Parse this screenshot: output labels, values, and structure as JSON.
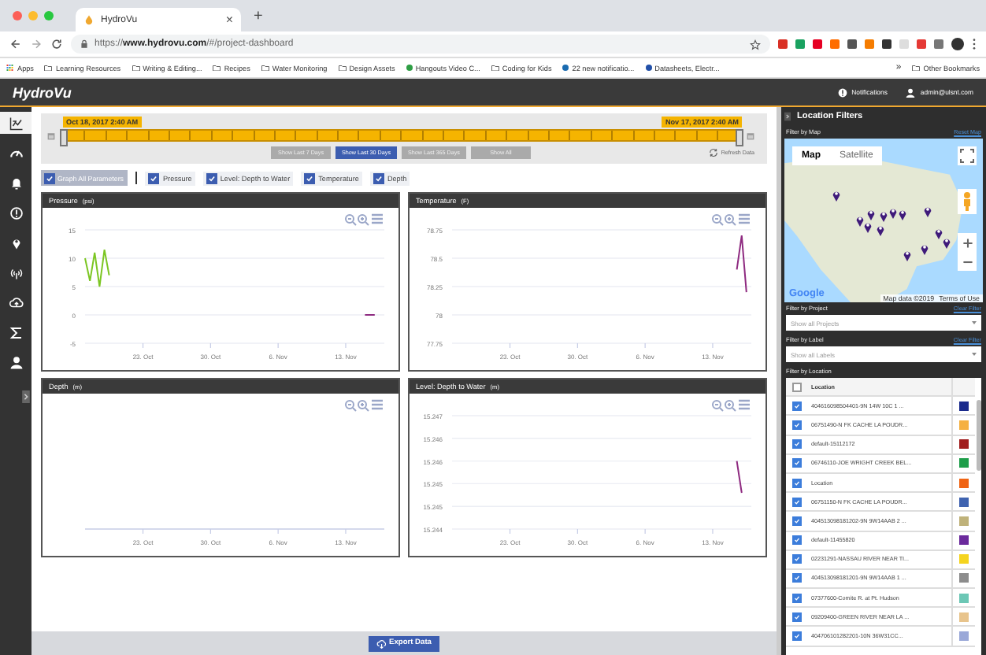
{
  "browser": {
    "tab": {
      "title": "HydroVu",
      "close": "×"
    },
    "new_tab": "+",
    "url": "https://**www.hydrovu.com**/#/project-dashboard",
    "bookmarks": [
      {
        "label": "Apps",
        "kind": "apps"
      },
      {
        "label": "Learning Resources",
        "kind": "folder"
      },
      {
        "label": "Writing & Editing...",
        "kind": "folder"
      },
      {
        "label": "Recipes",
        "kind": "folder"
      },
      {
        "label": "Water Monitoring",
        "kind": "folder"
      },
      {
        "label": "Design Assets",
        "kind": "folder"
      },
      {
        "label": "Hangouts Video C...",
        "kind": "site",
        "color": "#2e9e44"
      },
      {
        "label": "Coding for Kids",
        "kind": "folder"
      },
      {
        "label": "22 new notificatio...",
        "kind": "site",
        "color": "#1a6bb0"
      },
      {
        "label": "Datasheets, Electr...",
        "kind": "site",
        "color": "#2250a8"
      }
    ],
    "bookmarks_more": "»",
    "other_bookmarks": "Other Bookmarks"
  },
  "app": {
    "logo": "HydroVu",
    "notifications": "Notifications",
    "user": "admin@ulsnt.com"
  },
  "nav": [
    {
      "kind": "dashboard",
      "selected": true
    },
    {
      "kind": "gauge",
      "selected": false
    },
    {
      "kind": "bell",
      "selected": false
    },
    {
      "kind": "alert",
      "selected": false
    },
    {
      "kind": "pin",
      "selected": false
    },
    {
      "kind": "antenna",
      "selected": false
    },
    {
      "kind": "cloud",
      "selected": false
    },
    {
      "kind": "sigma",
      "selected": false
    },
    {
      "kind": "user",
      "selected": false
    }
  ],
  "time_range": {
    "start": "Oct 18, 2017 2:40 AM",
    "end": "Nov 17, 2017 2:40 AM",
    "slider": {
      "level": 1
    },
    "presets": [
      {
        "label": "Show Last 7 Days",
        "selected": false
      },
      {
        "label": "Show Last 30 Days",
        "selected": true
      },
      {
        "label": "Show Last 365 Days",
        "selected": false
      },
      {
        "label": "Show All",
        "selected": false
      }
    ],
    "refresh": "Refresh Data"
  },
  "parameters": {
    "all": {
      "label": "Graph All Parameters",
      "checked": true
    },
    "items": [
      {
        "label": "Pressure",
        "checked": true
      },
      {
        "label": "Level: Depth to Water",
        "checked": true
      },
      {
        "label": "Temperature",
        "checked": true
      },
      {
        "label": "Depth",
        "checked": true
      }
    ]
  },
  "charts": [
    {
      "title": "Pressure",
      "unit": "(psi)",
      "chart_data": {
        "type": "line",
        "grid": true,
        "ylim": [
          -5,
          15
        ],
        "yticks": [
          -5,
          0,
          5,
          10,
          15
        ],
        "categories": [
          null,
          null,
          null,
          null,
          null,
          null,
          null,
          null,
          null,
          null,
          null,
          null,
          "23. Oct",
          null,
          null,
          null,
          null,
          null,
          null,
          null,
          null,
          null,
          null,
          null,
          null,
          null,
          "30. Oct",
          null,
          null,
          null,
          null,
          null,
          null,
          null,
          null,
          null,
          null,
          null,
          null,
          null,
          "6. Nov",
          null,
          null,
          null,
          null,
          null,
          null,
          null,
          null,
          null,
          null,
          null,
          null,
          null,
          "13. Nov",
          null,
          null,
          null,
          null,
          null,
          null,
          null,
          null
        ],
        "series": [
          {
            "color": "#7cc623",
            "values": [
              10,
              6,
              11,
              5,
              11.5,
              7,
              null,
              null,
              null,
              null,
              null,
              null,
              null,
              null,
              null,
              null,
              null,
              null,
              null,
              null,
              null,
              null,
              null,
              null,
              null,
              null,
              null,
              null,
              null,
              null,
              null,
              null,
              null,
              null,
              null,
              null,
              null,
              null,
              null,
              null,
              null,
              null,
              null,
              null,
              null,
              null,
              null,
              null,
              null,
              null,
              null,
              null,
              null,
              null,
              null,
              null,
              null,
              null,
              null,
              null,
              null,
              null,
              null
            ]
          },
          {
            "color": "#8e2a80",
            "values": [
              null,
              null,
              null,
              null,
              null,
              null,
              null,
              null,
              null,
              null,
              null,
              null,
              null,
              null,
              null,
              null,
              null,
              null,
              null,
              null,
              null,
              null,
              null,
              null,
              null,
              null,
              null,
              null,
              null,
              null,
              null,
              null,
              null,
              null,
              null,
              null,
              null,
              null,
              null,
              null,
              null,
              null,
              null,
              null,
              null,
              null,
              null,
              null,
              null,
              null,
              null,
              null,
              null,
              null,
              null,
              null,
              null,
              null,
              0,
              0,
              0,
              null,
              null
            ]
          }
        ]
      }
    },
    {
      "title": "Temperature",
      "unit": "(F)",
      "chart_data": {
        "type": "line",
        "grid": true,
        "ylim": [
          77.75,
          78.75
        ],
        "yticks": [
          {
            "value": 77.75,
            "label": "77.75"
          },
          {
            "value": 78,
            "label": "78"
          },
          {
            "value": 78.25,
            "label": "78.25"
          },
          {
            "value": 78.5,
            "label": "78.5"
          },
          {
            "value": 78.75,
            "label": "78.75"
          }
        ],
        "categories": [
          null,
          null,
          null,
          null,
          null,
          null,
          null,
          null,
          null,
          null,
          null,
          null,
          "23. Oct",
          null,
          null,
          null,
          null,
          null,
          null,
          null,
          null,
          null,
          null,
          null,
          null,
          null,
          "30. Oct",
          null,
          null,
          null,
          null,
          null,
          null,
          null,
          null,
          null,
          null,
          null,
          null,
          null,
          "6. Nov",
          null,
          null,
          null,
          null,
          null,
          null,
          null,
          null,
          null,
          null,
          null,
          null,
          null,
          "13. Nov",
          null,
          null,
          null,
          null,
          null,
          null,
          null,
          null
        ],
        "series": [
          {
            "color": "#8e2a80",
            "values": [
              null,
              null,
              null,
              null,
              null,
              null,
              null,
              null,
              null,
              null,
              null,
              null,
              null,
              null,
              null,
              null,
              null,
              null,
              null,
              null,
              null,
              null,
              null,
              null,
              null,
              null,
              null,
              null,
              null,
              null,
              null,
              null,
              null,
              null,
              null,
              null,
              null,
              null,
              null,
              null,
              null,
              null,
              null,
              null,
              null,
              null,
              null,
              null,
              null,
              null,
              null,
              null,
              null,
              null,
              null,
              null,
              null,
              null,
              null,
              78.4,
              78.7,
              78.2,
              null
            ]
          }
        ]
      }
    },
    {
      "title": "Depth",
      "unit": "(m)",
      "x_labels": [
        "23. Oct",
        "30. Oct",
        "6. Nov",
        "13. Nov"
      ]
    },
    {
      "title": "Level: Depth to Water",
      "unit": "(m)",
      "chart_data": {
        "type": "line",
        "grid": true,
        "ylim": [
          15.2445,
          15.247
        ],
        "yticks": [
          {
            "value": 15.2445,
            "label": "15.244"
          },
          {
            "value": 15.245,
            "label": "15.245"
          },
          {
            "value": 15.2455,
            "label": "15.245"
          },
          {
            "value": 15.246,
            "label": "15.246"
          },
          {
            "value": 15.2465,
            "label": "15.246"
          },
          {
            "value": 15.247,
            "label": "15.247"
          }
        ],
        "categories": [
          null,
          null,
          null,
          null,
          null,
          null,
          null,
          null,
          null,
          null,
          null,
          null,
          "23. Oct",
          null,
          null,
          null,
          null,
          null,
          null,
          null,
          null,
          null,
          null,
          null,
          null,
          null,
          "30. Oct",
          null,
          null,
          null,
          null,
          null,
          null,
          null,
          null,
          null,
          null,
          null,
          null,
          null,
          "6. Nov",
          null,
          null,
          null,
          null,
          null,
          null,
          null,
          null,
          null,
          null,
          null,
          null,
          null,
          "13. Nov",
          null,
          null,
          null,
          null,
          null,
          null,
          null,
          null
        ],
        "series": [
          {
            "color": "#8e2a80",
            "values": [
              null,
              null,
              null,
              null,
              null,
              null,
              null,
              null,
              null,
              null,
              null,
              null,
              null,
              null,
              null,
              null,
              null,
              null,
              null,
              null,
              null,
              null,
              null,
              null,
              null,
              null,
              null,
              null,
              null,
              null,
              null,
              null,
              null,
              null,
              null,
              null,
              null,
              null,
              null,
              null,
              null,
              null,
              null,
              null,
              null,
              null,
              null,
              null,
              null,
              null,
              null,
              null,
              null,
              null,
              null,
              null,
              null,
              null,
              null,
              15.246,
              15.2453,
              null,
              null
            ]
          }
        ]
      }
    }
  ],
  "export": "Export Data",
  "filters": {
    "title": "Location Filters",
    "map": {
      "label": "Filter by Map",
      "reset": "Reset Map",
      "map_types": [
        {
          "label": "Map",
          "selected": true
        },
        {
          "label": "Satellite",
          "selected": false
        }
      ],
      "logo": "Google",
      "attribution": "Map data ©2019",
      "terms": "Terms of Use"
    },
    "project": {
      "label": "Filter by Project",
      "clear": "Clear Filter",
      "value": "Show all Projects"
    },
    "label_filter": {
      "label": "Filter by Label",
      "clear": "Clear Filter",
      "value": "Show all Labels"
    },
    "locations": {
      "label": "Filter by Location",
      "header": {
        "checked": false,
        "column": "Location"
      },
      "rows": [
        {
          "name": "404616098504401-9N 14W 10C 1 ...",
          "checked": true,
          "color": "#1a2a8c"
        },
        {
          "name": "06751490-N FK CACHE LA POUDR...",
          "checked": true,
          "color": "#f5b041"
        },
        {
          "name": "default-15112172",
          "checked": true,
          "color": "#a11d1d"
        },
        {
          "name": "06746110-JOE WRIGHT CREEK BEL...",
          "checked": true,
          "color": "#1e9e4a"
        },
        {
          "name": "Location",
          "checked": true,
          "color": "#f06414"
        },
        {
          "name": "06751150-N FK CACHE LA POUDR...",
          "checked": true,
          "color": "#3f63b0"
        },
        {
          "name": "404513098181202-9N 9W14AAB 2 ...",
          "checked": true,
          "color": "#bfb27a"
        },
        {
          "name": "default-11455820",
          "checked": true,
          "color": "#6b2a9c"
        },
        {
          "name": "02231291-NASSAU RIVER NEAR TI...",
          "checked": true,
          "color": "#f5d41f"
        },
        {
          "name": "404513098181201-9N 9W14AAB 1 ...",
          "checked": true,
          "color": "#8c8c8c"
        },
        {
          "name": "07377600-Comite R. at Pt. Hudson",
          "checked": true,
          "color": "#6cc7b5"
        },
        {
          "name": "09209400-GREEN RIVER NEAR LA ...",
          "checked": true,
          "color": "#e8c48c"
        },
        {
          "name": "404706101282201-10N 36W31CC...",
          "checked": true,
          "color": "#9aa8d8"
        }
      ]
    }
  }
}
